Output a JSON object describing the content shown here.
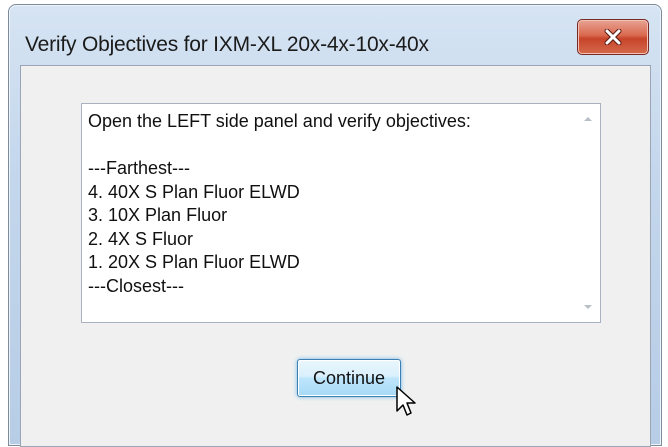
{
  "dialog": {
    "title": "Verify Objectives for IXM-XL 20x-4x-10x-40x",
    "close_icon": "close-x-icon"
  },
  "message": {
    "lines": [
      "Open the LEFT side panel and verify objectives:",
      "",
      "---Farthest---",
      "4. 40X S Plan Fluor ELWD",
      "3. 10X Plan Fluor",
      "2. 4X S Fluor",
      "1. 20X S Plan Fluor ELWD",
      "---Closest---"
    ]
  },
  "buttons": {
    "continue_label": "Continue"
  },
  "icons": {
    "scroll_up": "scroll-up-arrow-icon",
    "scroll_down": "scroll-down-arrow-icon",
    "cursor": "mouse-pointer-icon"
  },
  "colors": {
    "close_button": "#c6442a",
    "default_button_border": "#3c7fb1",
    "window_frame": "#c3d6ec"
  }
}
